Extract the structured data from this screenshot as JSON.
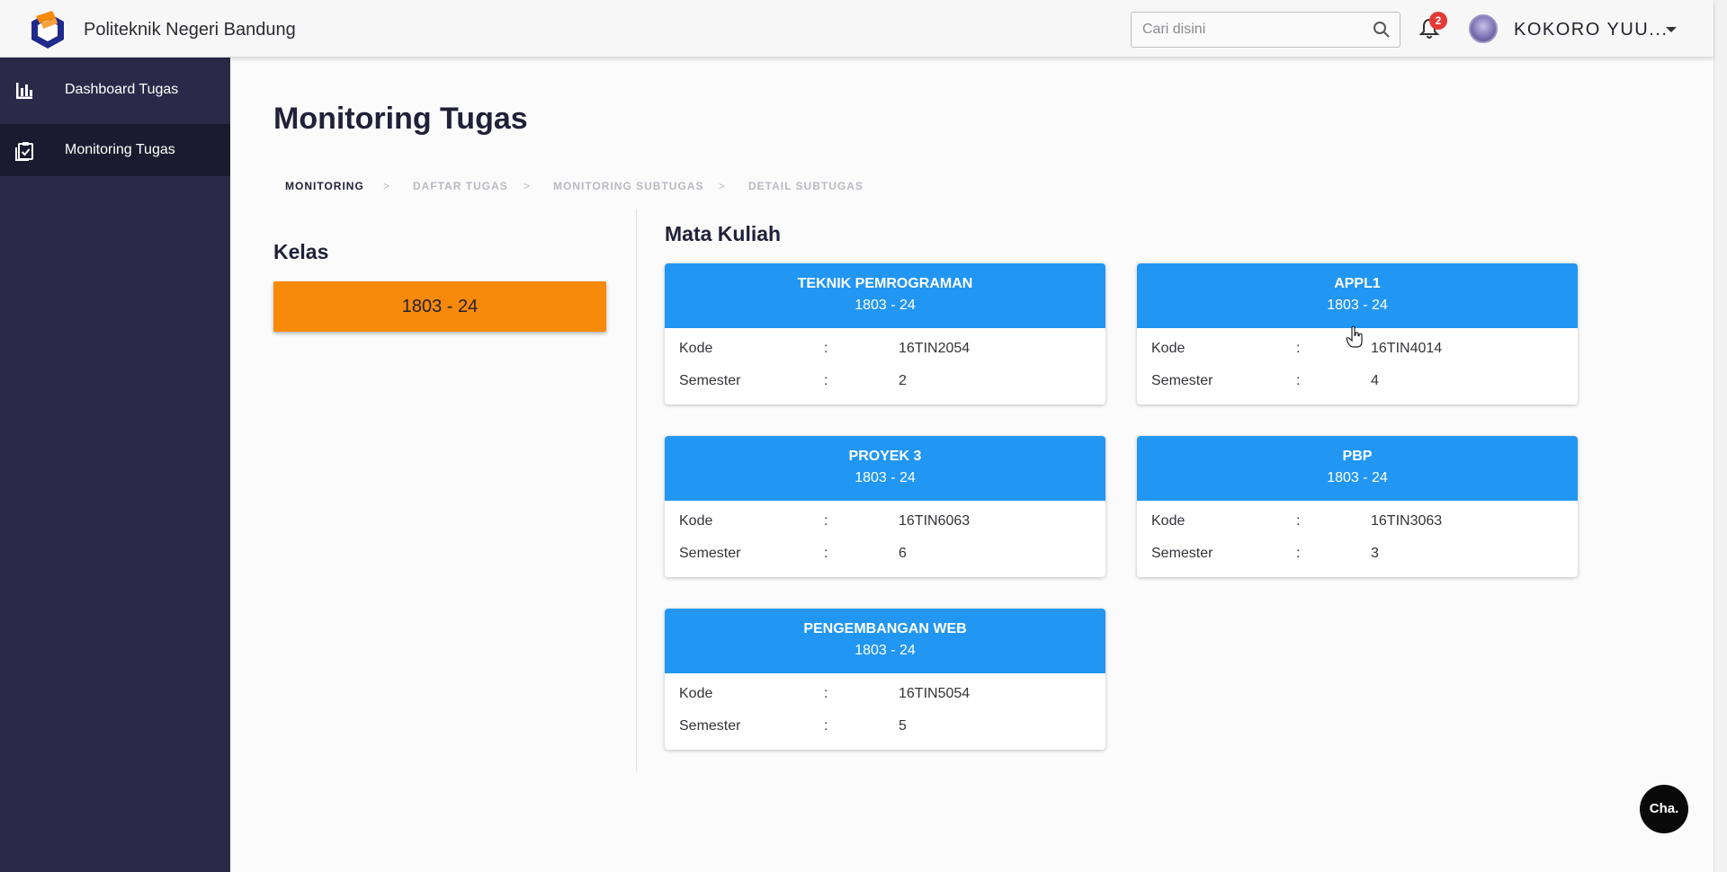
{
  "header": {
    "brand": "Politeknik Negeri Bandung",
    "search_placeholder": "Cari disini",
    "notification_count": "2",
    "user_name": "KOKORO YUU..."
  },
  "sidebar": {
    "items": [
      {
        "label": "Dashboard Tugas",
        "icon": "bar-chart-icon",
        "active": false
      },
      {
        "label": "Monitoring Tugas",
        "icon": "clipboard-check-icon",
        "active": true
      }
    ]
  },
  "main": {
    "title": "Monitoring Tugas",
    "breadcrumb": {
      "items": [
        "MONITORING",
        "DAFTAR TUGAS",
        "MONITORING SUBTUGAS",
        "DETAIL SUBTUGAS"
      ],
      "separator": ">"
    },
    "kelas": {
      "title": "Kelas",
      "selected": "1803 - 24"
    },
    "mata_kuliah": {
      "title": "Mata Kuliah",
      "kode_label": "Kode",
      "semester_label": "Semester",
      "colon": ":",
      "cards": [
        {
          "name": "TEKNIK PEMROGRAMAN",
          "kelas": "1803 - 24",
          "kode": "16TIN2054",
          "semester": "2"
        },
        {
          "name": "APPL1",
          "kelas": "1803 - 24",
          "kode": "16TIN4014",
          "semester": "4"
        },
        {
          "name": "PROYEK 3",
          "kelas": "1803 - 24",
          "kode": "16TIN6063",
          "semester": "6"
        },
        {
          "name": "PBP",
          "kelas": "1803 - 24",
          "kode": "16TIN3063",
          "semester": "3"
        },
        {
          "name": "PENGEMBANGAN WEB",
          "kelas": "1803 - 24",
          "kode": "16TIN5054",
          "semester": "5"
        }
      ]
    }
  },
  "chat_button": "Cha.",
  "colors": {
    "sidebar": "#2a2a48",
    "sidebar_active": "#1b1b30",
    "card_header": "#2196f3",
    "kelas_button": "#f7890b",
    "badge": "#e53935"
  }
}
